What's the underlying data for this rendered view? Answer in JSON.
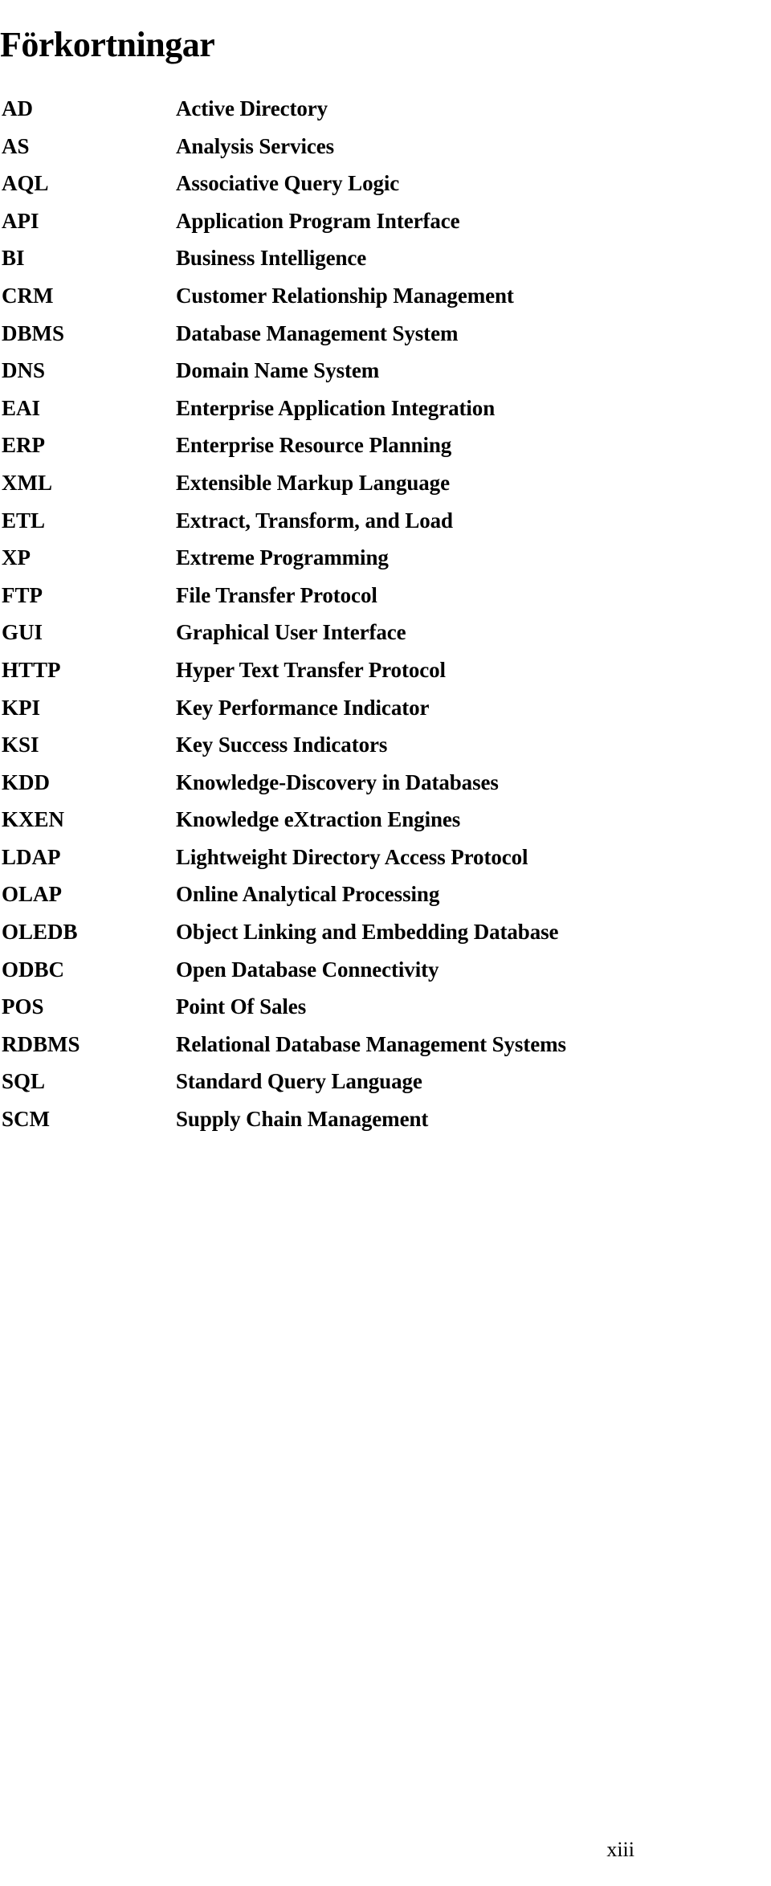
{
  "document": {
    "title": "Förkortningar",
    "page_number": "xiii"
  },
  "abbreviations": [
    {
      "term": "AD",
      "definition": "Active Directory"
    },
    {
      "term": "AS",
      "definition": "Analysis Services"
    },
    {
      "term": "AQL",
      "definition": "Associative Query Logic"
    },
    {
      "term": "API",
      "definition": "Application Program Interface"
    },
    {
      "term": "BI",
      "definition": "Business Intelligence"
    },
    {
      "term": "CRM",
      "definition": "Customer Relationship Management"
    },
    {
      "term": "DBMS",
      "definition": "Database Management System"
    },
    {
      "term": "DNS",
      "definition": "Domain Name System"
    },
    {
      "term": "EAI",
      "definition": "Enterprise Application Integration"
    },
    {
      "term": "ERP",
      "definition": "Enterprise Resource Planning"
    },
    {
      "term": "XML",
      "definition": "Extensible Markup Language"
    },
    {
      "term": "ETL",
      "definition": "Extract, Transform, and Load"
    },
    {
      "term": "XP",
      "definition": "Extreme Programming"
    },
    {
      "term": "FTP",
      "definition": "File Transfer Protocol"
    },
    {
      "term": "GUI",
      "definition": "Graphical User Interface"
    },
    {
      "term": "HTTP",
      "definition": "Hyper Text Transfer Protocol"
    },
    {
      "term": "KPI",
      "definition": "Key Performance Indicator"
    },
    {
      "term": "KSI",
      "definition": "Key Success Indicators"
    },
    {
      "term": "KDD",
      "definition": "Knowledge-Discovery in Databases"
    },
    {
      "term": "KXEN",
      "definition": "Knowledge eXtraction Engines"
    },
    {
      "term": "LDAP",
      "definition": "Lightweight Directory Access Protocol"
    },
    {
      "term": "OLAP",
      "definition": "Online Analytical Processing"
    },
    {
      "term": "OLEDB",
      "definition": "Object Linking and Embedding Database"
    },
    {
      "term": "ODBC",
      "definition": "Open Database Connectivity"
    },
    {
      "term": "POS",
      "definition": "Point Of Sales"
    },
    {
      "term": "RDBMS",
      "definition": "Relational Database Management Systems"
    },
    {
      "term": "SQL",
      "definition": "Standard Query Language"
    },
    {
      "term": "SCM",
      "definition": "Supply Chain Management"
    }
  ]
}
